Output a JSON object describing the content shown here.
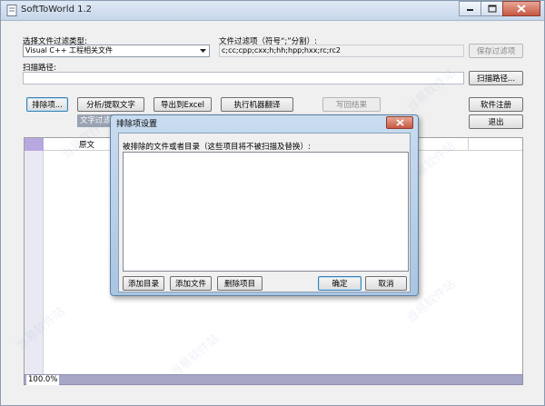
{
  "window": {
    "title": "SoftToWorld 1.2"
  },
  "filter_type": {
    "label": "选择文件过滤类型:",
    "selected": "Visual C++ 工程相关文件"
  },
  "filter_items": {
    "label": "文件过滤项（符号“;”分割）:",
    "value": "c;cc;cpp;cxx;h;hh;hpp;hxx;rc;rc2",
    "save_button": "保存过滤项"
  },
  "scan_path": {
    "label": "扫描路径:",
    "value": "",
    "button": "扫描路径..."
  },
  "toolbar": {
    "exclude_button": "排除项...",
    "analyze_button": "分析/提取文字",
    "export_button": "导出到Excel",
    "translate_button": "执行机器翻译",
    "writeback_button": "写回结果",
    "register_button": "软件注册",
    "exit_button": "退出"
  },
  "tab_label": "文字过滤",
  "grid": {
    "column1": "原文"
  },
  "status": {
    "progress_text": "100.0%",
    "progress": 1.0
  },
  "dialog": {
    "title": "排除项设置",
    "prompt": "被排除的文件或者目录（这些项目将不被扫描及替换）:",
    "items": [],
    "add_dir_button": "添加目录",
    "add_file_button": "添加文件",
    "delete_button": "删除项目",
    "ok_button": "确定",
    "cancel_button": "取消"
  },
  "watermark": "当易软件站",
  "colors": {
    "title_bar": "#c6d6ea",
    "close": "#c75843",
    "status_bar": "#a6a6c7",
    "grid_corner": "#b7a8e0"
  }
}
